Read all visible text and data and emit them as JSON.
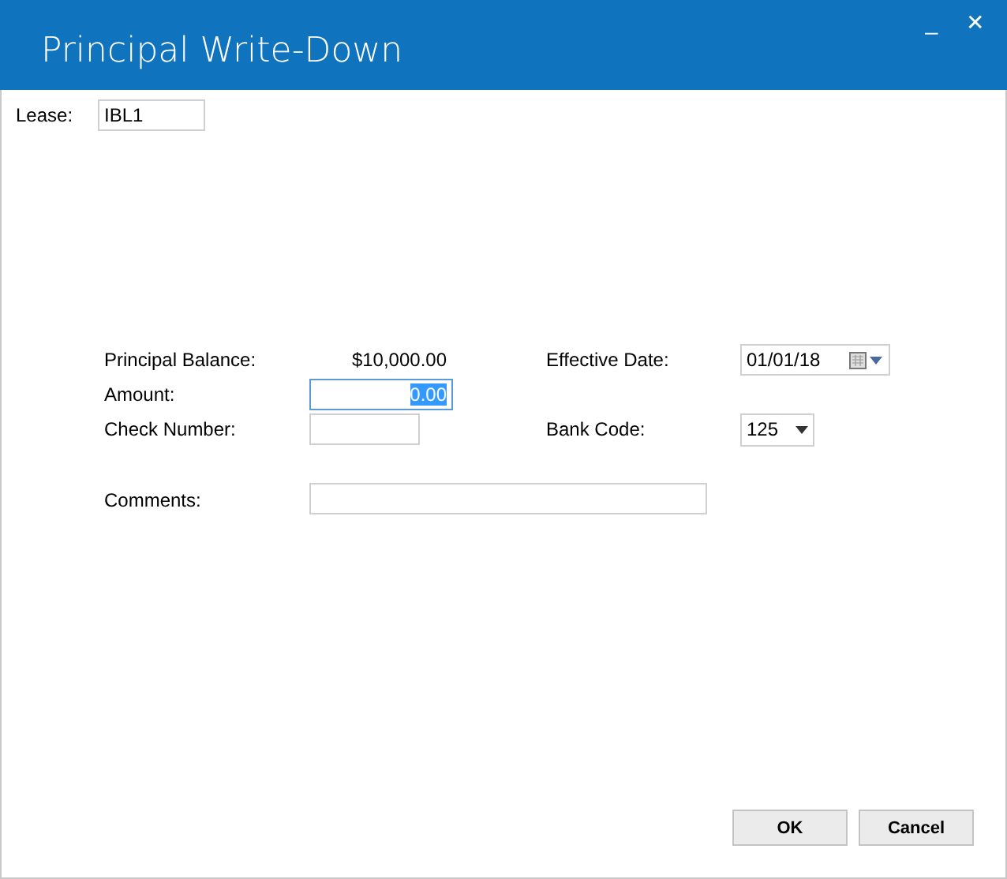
{
  "window": {
    "title": "Principal Write-Down",
    "controls": [
      "_",
      "✕"
    ]
  },
  "lease": {
    "label": "Lease:",
    "value": "IBL1"
  },
  "form": {
    "principal_balance": {
      "label": "Principal Balance:",
      "value": "$10,000.00"
    },
    "effective_date": {
      "label": "Effective Date:",
      "value": "01/01/18"
    },
    "amount": {
      "label": "Amount:",
      "value": "0.00",
      "focused": true,
      "text_selected": true
    },
    "check_number": {
      "label": "Check Number:"
    },
    "bank_code": {
      "label": "Bank Code:",
      "value": "125"
    },
    "comments": {
      "label": "Comments:"
    }
  },
  "buttons": [
    {
      "label": "OK"
    },
    {
      "label": "Cancel"
    }
  ]
}
